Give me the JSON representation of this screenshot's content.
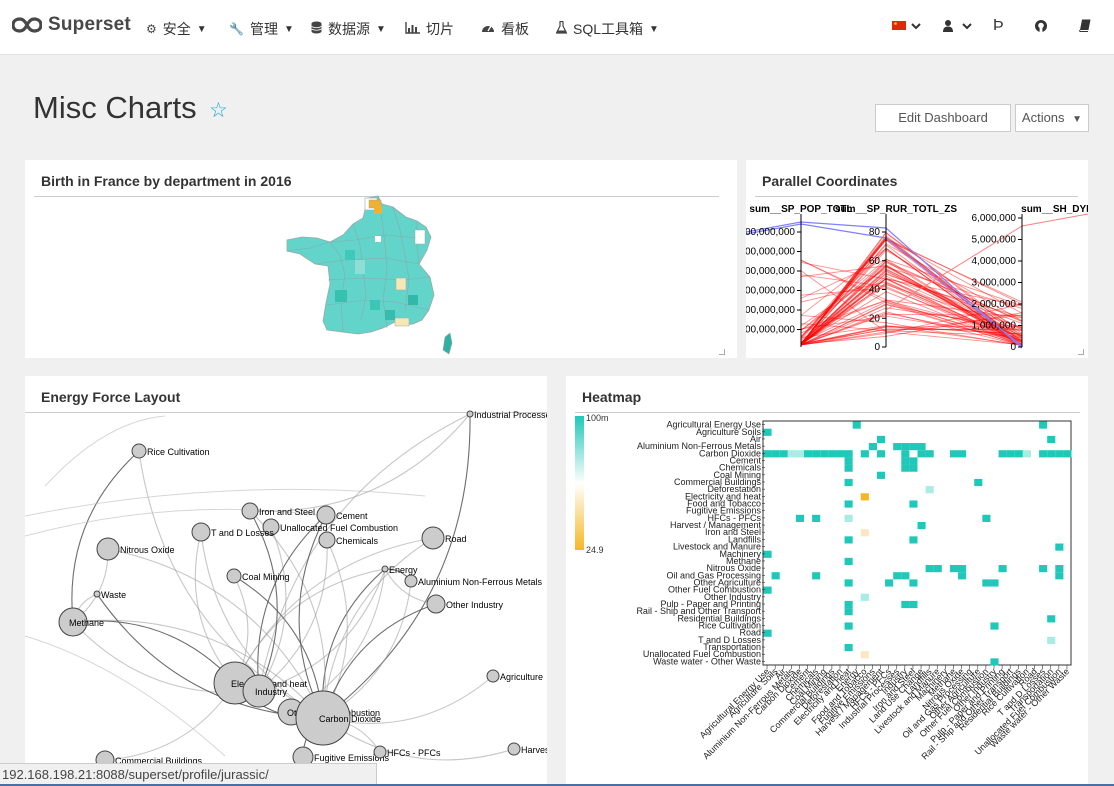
{
  "nav": {
    "brand": "Superset",
    "items": [
      {
        "label": "安全",
        "icon": "gears-icon",
        "has_caret": true
      },
      {
        "label": "管理",
        "icon": "wrench-icon",
        "has_caret": true
      },
      {
        "label": "数据源",
        "icon": "database-icon",
        "has_caret": true
      },
      {
        "label": "切片",
        "icon": "bar-chart-icon",
        "has_caret": false
      },
      {
        "label": "看板",
        "icon": "dashboard-icon",
        "has_caret": false
      },
      {
        "label": "SQL工具箱",
        "icon": "flask-icon",
        "has_caret": true
      }
    ],
    "right_icons": [
      "flag-cn-icon",
      "user-icon",
      "beta-icon",
      "github-icon",
      "book-icon"
    ]
  },
  "dashboard": {
    "title": "Misc Charts",
    "edit_label": "Edit Dashboard",
    "actions_label": "Actions"
  },
  "panels": {
    "france": {
      "title": "Birth in France by department in 2016"
    },
    "parallel": {
      "title": "Parallel Coordinates"
    },
    "force": {
      "title": "Energy Force Layout"
    },
    "heatmap": {
      "title": "Heatmap"
    }
  },
  "status_url": "192.168.198.21:8088/superset/profile/jurassic/",
  "chart_data": [
    {
      "type": "parallel_coordinates",
      "axes": [
        {
          "name": "sum__SP_POP_TOTL",
          "ticks": [
            "00,000,000",
            "00,000,000",
            "00,000,000",
            "00,000,000",
            "00,000,000",
            "00,000,000"
          ]
        },
        {
          "name": "sum__SP_RUR_TOTL_ZS",
          "ticks": [
            "0",
            "20",
            "40",
            "60",
            "80"
          ]
        },
        {
          "name": "sum__SH_DYN_AIDS",
          "ticks": [
            "0",
            "1,000,000",
            "2,000,000",
            "3,000,000",
            "4,000,000",
            "5,000,000",
            "6,000,000"
          ]
        }
      ],
      "line_color": "#ff0000",
      "highlight_color": "#8080ff"
    },
    {
      "type": "heatmap",
      "y_categories": [
        "Agricultural Energy Use",
        "Agriculture Soils",
        "Air",
        "Aluminium Non-Ferrous Metals",
        "Carbon Dioxide",
        "Cement",
        "Chemicals",
        "Coal Mining",
        "Commercial Buildings",
        "Deforestation",
        "Electricity and heat",
        "Food and Tobacco",
        "Fugitive Emissions",
        "HFCs - PFCs",
        "Harvest / Management",
        "Iron and Steel",
        "Landfills",
        "Livestock and Manure",
        "Machinery",
        "Methane",
        "Nitrous Oxide",
        "Oil and Gas Processing",
        "Other Agriculture",
        "Other Fuel Combustion",
        "Other Industry",
        "Pulp - Paper and Printing",
        "Rail - Ship and Other Transport",
        "Residential Buildings",
        "Rice Cultivation",
        "Road",
        "T and D Losses",
        "Transportation",
        "Unallocated Fuel Combustion",
        "Waste water - Other Waste"
      ],
      "x_categories": [
        "Agricultural Energy Use",
        "Agriculture Soils",
        "Air",
        "Aluminium Non-Ferrous Metals",
        "Carbon Dioxide",
        "Cement",
        "Chemicals",
        "Coal Mining",
        "Commercial Buildings",
        "Deforestation",
        "Electricity and heat",
        "Energy",
        "Food and Tobacco",
        "Fugitive Emissions",
        "Harvest / Management",
        "HFCs - PFCs",
        "Industrial Processes",
        "Industry",
        "Iron and Steel",
        "Land Use Change",
        "Landfills",
        "Livestock and Manure",
        "Machinery",
        "Methane",
        "Nitrous Oxide",
        "Oil and Gas Processing",
        "Other Agriculture",
        "Other Fuel Combustion",
        "Other Industry",
        "Pulp - Paper and Printing",
        "Rail - Ship and Other Transport",
        "Residential Buildings",
        "Rice Cultivation",
        "Road",
        "T and D Losses",
        "Transportation",
        "Unallocated Fuel Combustion",
        "Waste water - Other Waste"
      ],
      "legend": {
        "max_label": "100m",
        "min_label": "24.9",
        "colors": [
          "#1fc8b8",
          "#ffffff",
          "#f5b820"
        ]
      }
    },
    {
      "type": "force_layout",
      "nodes": [
        "Industrial Processes",
        "Rice Cultivation",
        "Iron and Steel",
        "Cement",
        "Unallocated Fuel Combustion",
        "T and D Losses",
        "Chemicals",
        "Road",
        "Nitrous Oxide",
        "Energy",
        "Coal Mining",
        "Aluminium Non-Ferrous Metals",
        "Waste",
        "Other Industry",
        "Methane",
        "Agriculture",
        "Electricity and heat",
        "Industry",
        "Other Fuel Combustion",
        "Carbon Dioxide",
        "Commercial Buildings",
        "Fugitive Emissions",
        "HFCs - PFCs",
        "Harvest"
      ]
    }
  ]
}
